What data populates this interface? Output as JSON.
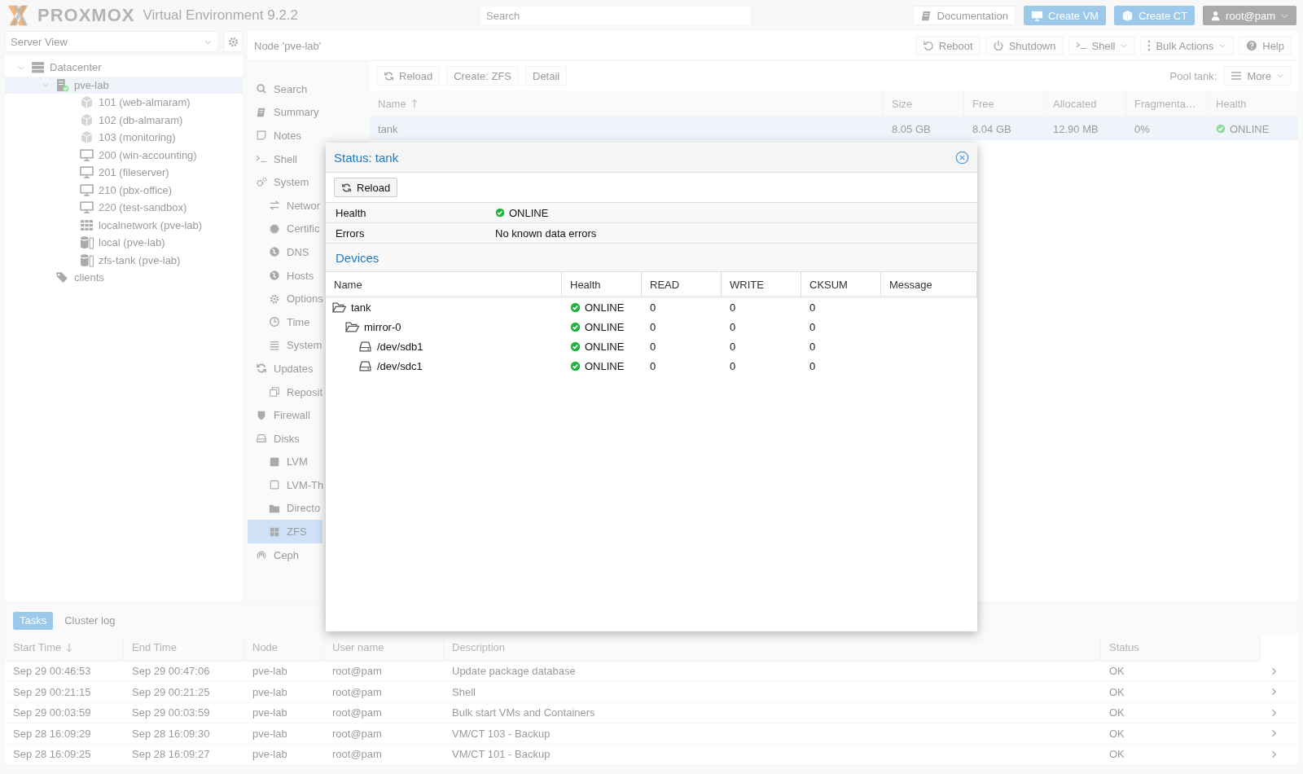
{
  "header": {
    "logo": "PROXMOX",
    "version": "Virtual Environment 9.2.2",
    "search": {
      "placeholder": "Search"
    },
    "buttons": [
      {
        "label": "Documentation",
        "kind": "plain"
      },
      {
        "label": "Create VM",
        "kind": "primary"
      },
      {
        "label": "Create CT",
        "kind": "primary"
      }
    ],
    "user": "root@pam"
  },
  "sidebar": {
    "view": "Server View",
    "tree": [
      {
        "label": "Datacenter",
        "kind": "datacenter",
        "selected": false,
        "expanded": true,
        "children": [
          {
            "label": "pve-lab",
            "kind": "node",
            "selected": true,
            "expanded": true,
            "children": [
              {
                "label": "101 (web-almaram)",
                "kind": "ct",
                "selected": false
              },
              {
                "label": "102 (db-almaram)",
                "kind": "ct",
                "selected": false
              },
              {
                "label": "103 (monitoring)",
                "kind": "ct",
                "selected": false
              },
              {
                "label": "200 (win-accounting)",
                "kind": "vm",
                "selected": false
              },
              {
                "label": "201 (fileserver)",
                "kind": "vm",
                "selected": false
              },
              {
                "label": "210 (pbx-office)",
                "kind": "vm",
                "selected": false
              },
              {
                "label": "220 (test-sandbox)",
                "kind": "vm",
                "selected": false
              },
              {
                "label": "localnetwork (pve-lab)",
                "kind": "sdn",
                "selected": false
              },
              {
                "label": "local (pve-lab)",
                "kind": "storage",
                "selected": false
              },
              {
                "label": "zfs-tank (pve-lab)",
                "kind": "storage",
                "selected": false
              }
            ]
          },
          {
            "label": "clients",
            "kind": "pool",
            "selected": false
          }
        ]
      }
    ]
  },
  "node_panel": {
    "title": "Node 'pve-lab'",
    "buttons": [
      {
        "label": "Reboot",
        "menu": false
      },
      {
        "label": "Shutdown",
        "menu": false
      },
      {
        "label": "Shell",
        "menu": true
      },
      {
        "label": "Bulk Actions",
        "menu": true
      },
      {
        "label": "Help",
        "menu": false
      }
    ],
    "nav": [
      {
        "label": "Search",
        "selected": false
      },
      {
        "label": "Summary",
        "selected": false
      },
      {
        "label": "Notes",
        "selected": false
      },
      {
        "label": "Shell",
        "selected": false
      },
      {
        "label": "System",
        "selected": false,
        "children": [
          {
            "label": "Networ",
            "selected": false
          },
          {
            "label": "Certific",
            "selected": false
          },
          {
            "label": "DNS",
            "selected": false
          },
          {
            "label": "Hosts",
            "selected": false
          },
          {
            "label": "Options",
            "selected": false
          },
          {
            "label": "Time",
            "selected": false
          },
          {
            "label": "System",
            "selected": false
          }
        ]
      },
      {
        "label": "Updates",
        "selected": false,
        "children": [
          {
            "label": "Reposit",
            "selected": false
          }
        ]
      },
      {
        "label": "Firewall",
        "selected": false
      },
      {
        "label": "Disks",
        "selected": false,
        "children": [
          {
            "label": "LVM",
            "selected": false
          },
          {
            "label": "LVM-Th",
            "selected": false
          },
          {
            "label": "Directo",
            "selected": false
          },
          {
            "label": "ZFS",
            "selected": true
          }
        ]
      },
      {
        "label": "Ceph",
        "selected": false
      }
    ],
    "toolbar": {
      "buttons": [
        "Reload",
        "Create: ZFS",
        "Detail"
      ],
      "pool_label": "Pool tank:",
      "more": "More"
    },
    "pools": {
      "columns": [
        "Name",
        "Size",
        "Free",
        "Allocated",
        "Fragmenta…",
        "Health"
      ],
      "rows": [
        {
          "cells": [
            "tank",
            "8.05 GB",
            "8.04 GB",
            "12.90 MB",
            "0%",
            "ONLINE"
          ],
          "selected": true
        }
      ]
    }
  },
  "dialog": {
    "title": "Status: tank",
    "reload": "Reload",
    "properties": [
      {
        "key": "Health",
        "value": "ONLINE",
        "kind": "health"
      },
      {
        "key": "Errors",
        "value": "No known data errors",
        "kind": "text"
      }
    ],
    "devices_title": "Devices",
    "devices": {
      "columns": [
        "Name",
        "Health",
        "READ",
        "WRITE",
        "CKSUM",
        "Message"
      ],
      "rows": [
        {
          "name": "tank",
          "health": "ONLINE",
          "read": "0",
          "write": "0",
          "cksum": "0",
          "children": [
            {
              "name": "mirror-0",
              "health": "ONLINE",
              "read": "0",
              "write": "0",
              "cksum": "0",
              "children": [
                {
                  "name": "/dev/sdb1",
                  "health": "ONLINE",
                  "read": "0",
                  "write": "0",
                  "cksum": "0"
                },
                {
                  "name": "/dev/sdc1",
                  "health": "ONLINE",
                  "read": "0",
                  "write": "0",
                  "cksum": "0"
                }
              ]
            }
          ]
        }
      ]
    }
  },
  "tasks": {
    "tabs": [
      {
        "label": "Tasks",
        "selected": true
      },
      {
        "label": "Cluster log",
        "selected": false
      }
    ],
    "columns": [
      "Start Time",
      "End Time",
      "Node",
      "User name",
      "Description",
      "Status"
    ],
    "rows": [
      {
        "cells": [
          "Sep 29 00:46:53",
          "Sep 29 00:47:06",
          "pve-lab",
          "root@pam",
          "Update package database",
          "OK"
        ]
      },
      {
        "cells": [
          "Sep 29 00:21:15",
          "Sep 29 00:21:25",
          "pve-lab",
          "root@pam",
          "Shell",
          "OK"
        ]
      },
      {
        "cells": [
          "Sep 29 00:03:59",
          "Sep 29 00:03:59",
          "pve-lab",
          "root@pam",
          "Bulk start VMs and Containers",
          "OK"
        ]
      },
      {
        "cells": [
          "Sep 28 16:09:29",
          "Sep 28 16:09:30",
          "pve-lab",
          "root@pam",
          "VM/CT 103 - Backup",
          "OK"
        ]
      },
      {
        "cells": [
          "Sep 28 16:09:25",
          "Sep 28 16:09:27",
          "pve-lab",
          "root@pam",
          "VM/CT 101 - Backup",
          "OK"
        ]
      }
    ]
  }
}
